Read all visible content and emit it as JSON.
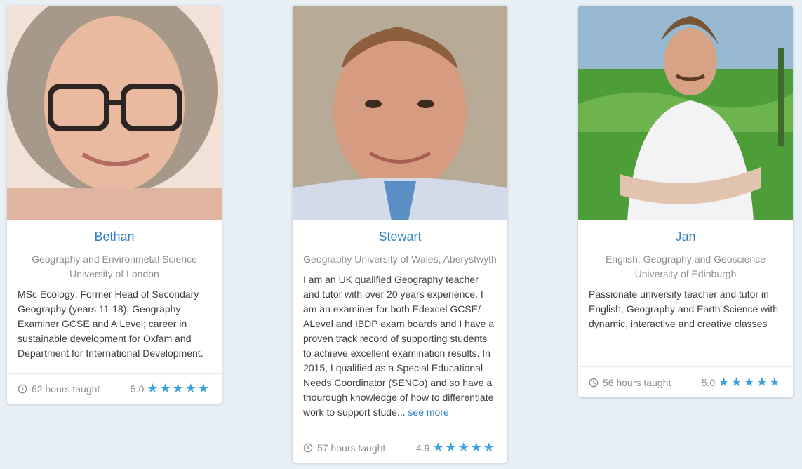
{
  "tutors": [
    {
      "name": "Bethan",
      "subject": "Geography and Environmetal Science",
      "university": "University of London",
      "bio": "MSc Ecology; Former Head of Secondary Geography (years 11-18); Geography Examiner GCSE and A Level; career in sustainable development for Oxfam and Department for International Development.",
      "hours": "62 hours taught",
      "rating": "5.0",
      "stars": "★★★★★",
      "clock_icon": "clock-icon"
    },
    {
      "name": "Stewart",
      "subject": "Geography University of Wales, Aberystwyth",
      "university": "",
      "bio": "I am an UK qualified Geography teacher and tutor with over 20 years experience. I am an examiner for both Edexcel GCSE/ ALevel and IBDP exam boards and I have a proven track record of supporting students to achieve excellent examination results. In 2015, I qualified as a Special Educational Needs Coordinator (SENCo) and so have a thourough knowledge of how to differentiate work to support stude...",
      "see_more": "see more",
      "hours": "57 hours taught",
      "rating": "4.9",
      "stars": "★★★★★",
      "clock_icon": "clock-icon"
    },
    {
      "name": "Jan",
      "subject": "English, Geography and Geoscience",
      "university": "University of Edinburgh",
      "bio": "Passionate university teacher and tutor in English, Geography and Earth Science with dynamic, interactive and creative classes",
      "hours": "56 hours taught",
      "rating": "5.0",
      "stars": "★★★★★",
      "clock_icon": "clock-icon"
    }
  ],
  "colors": {
    "background": "#e8f0f6",
    "name": "#2e7fc4",
    "star": "#3da0e0",
    "muted": "#8a8f94"
  }
}
